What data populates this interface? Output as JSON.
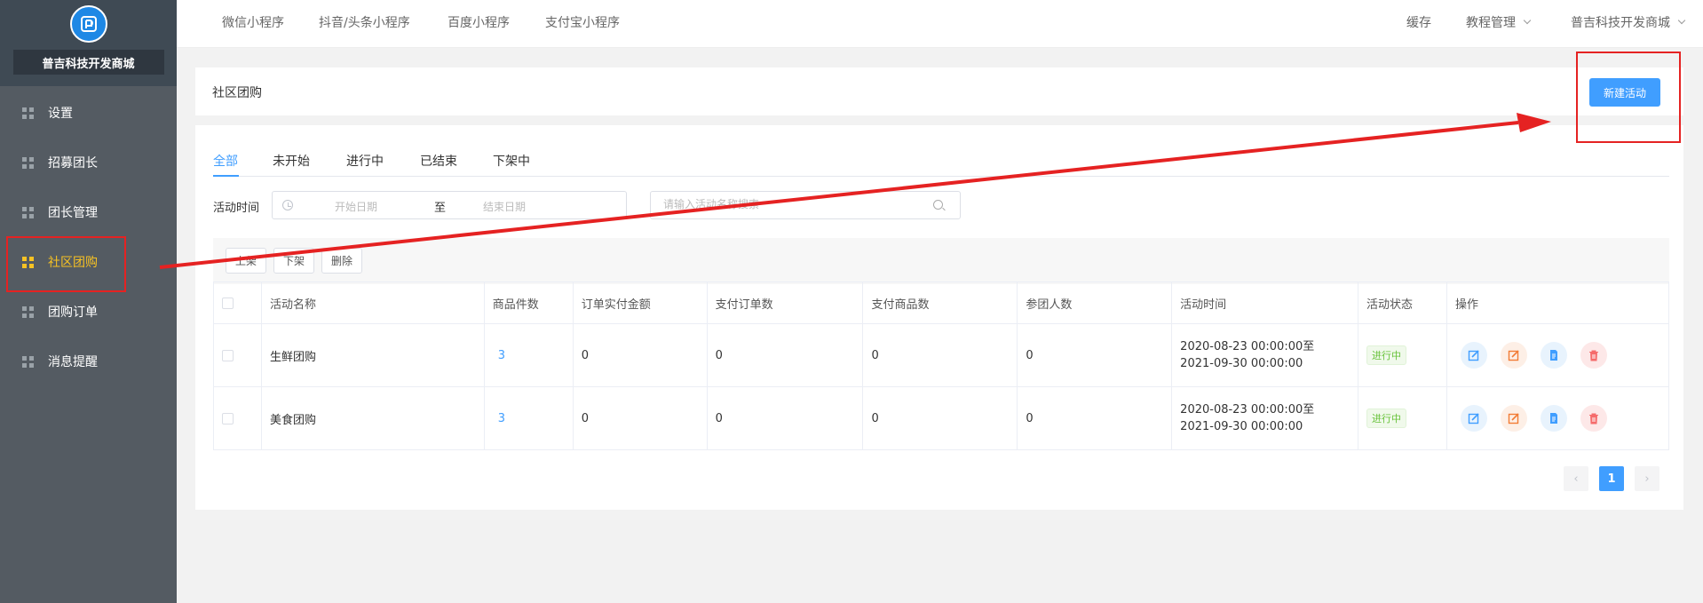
{
  "sidebar": {
    "shop_name": "普吉科技开发商城",
    "items": [
      {
        "label": "设置",
        "active": false
      },
      {
        "label": "招募团长",
        "active": false
      },
      {
        "label": "团长管理",
        "active": false
      },
      {
        "label": "社区团购",
        "active": true
      },
      {
        "label": "团购订单",
        "active": false
      },
      {
        "label": "消息提醒",
        "active": false
      }
    ]
  },
  "topbar": {
    "nav": [
      "微信小程序",
      "抖音/头条小程序",
      "百度小程序",
      "支付宝小程序"
    ],
    "right": [
      "缓存",
      "教程管理",
      "普吉科技开发商城"
    ]
  },
  "header": {
    "title": "社区团购",
    "new_button": "新建活动"
  },
  "tabs": [
    "全部",
    "未开始",
    "进行中",
    "已结束",
    "下架中"
  ],
  "filter": {
    "label": "活动时间",
    "start_placeholder": "开始日期",
    "separator": "至",
    "end_placeholder": "结束日期",
    "search_placeholder": "请输入活动名称搜索"
  },
  "toolbar": [
    "上架",
    "下架",
    "删除"
  ],
  "table": {
    "columns": [
      "活动名称",
      "商品件数",
      "订单实付金额",
      "支付订单数",
      "支付商品数",
      "参团人数",
      "活动时间",
      "活动状态",
      "操作"
    ],
    "rows": [
      {
        "name": "生鲜团购",
        "items": "3",
        "amount": "0",
        "orders": "0",
        "goods": "0",
        "people": "0",
        "time_start": "2020-08-23 00:00:00至",
        "time_end": "2021-09-30 00:00:00",
        "status": "进行中"
      },
      {
        "name": "美食团购",
        "items": "3",
        "amount": "0",
        "orders": "0",
        "goods": "0",
        "people": "0",
        "time_start": "2020-08-23 00:00:00至",
        "time_end": "2021-09-30 00:00:00",
        "status": "进行中"
      }
    ]
  },
  "pagination": {
    "prev": "‹",
    "current": "1",
    "next": "›"
  },
  "colors": {
    "primary": "#409eff",
    "sidebar": "#545b62",
    "active_menu": "#f7c223",
    "annotation": "#e52222"
  }
}
